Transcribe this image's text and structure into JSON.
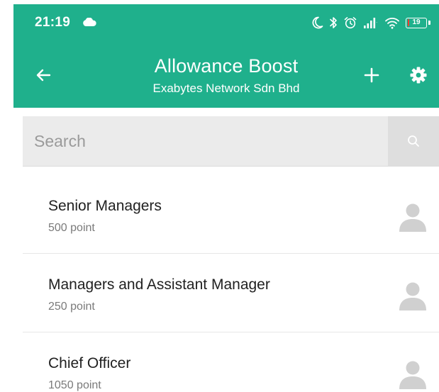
{
  "status_bar": {
    "time": "21:19",
    "battery_level": "19",
    "icons": [
      "cloud-icon",
      "moon-icon",
      "bluetooth-icon",
      "alarm-icon",
      "signal-icon",
      "wifi-icon",
      "battery-icon"
    ]
  },
  "app_bar": {
    "title": "Allowance Boost",
    "subtitle": "Exabytes Network Sdn Bhd",
    "icons": [
      "back-arrow-icon",
      "plus-icon",
      "gear-icon"
    ]
  },
  "search": {
    "placeholder": "Search",
    "value": ""
  },
  "list": {
    "items": [
      {
        "title": "Senior Managers",
        "points": "500 point"
      },
      {
        "title": "Managers and Assistant Manager",
        "points": "250 point"
      },
      {
        "title": "Chief Officer",
        "points": "1050 point"
      }
    ]
  },
  "colors": {
    "accent": "#1fb08c",
    "search_bg": "#ebebeb",
    "battery_low": "#ff3b30",
    "avatar_gray": "#d0d0d0"
  }
}
